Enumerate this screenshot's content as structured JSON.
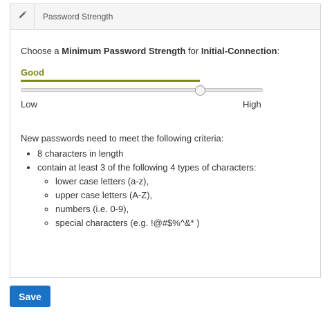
{
  "panel": {
    "title": "Password Strength",
    "edit_icon": "pencil-icon"
  },
  "prompt": {
    "prefix": "Choose a ",
    "strength_term": "Minimum Password Strength",
    "middle": " for ",
    "connection": "Initial-Connection",
    "suffix": ":"
  },
  "strength": {
    "label": "Good",
    "color": "#7c8a0e",
    "level_fraction": 0.74
  },
  "slider": {
    "low_label": "Low",
    "high_label": "High"
  },
  "criteria": {
    "intro": "New passwords need to meet the following criteria:",
    "items": [
      "8 characters in length",
      "contain at least 3 of the following 4 types of characters:"
    ],
    "sub_items": [
      "lower case letters (a-z),",
      "upper case letters (A-Z),",
      "numbers (i.e. 0-9),",
      "special characters (e.g. !@#$%^&* )"
    ]
  },
  "actions": {
    "save_label": "Save",
    "save_color": "#1a72c7"
  }
}
